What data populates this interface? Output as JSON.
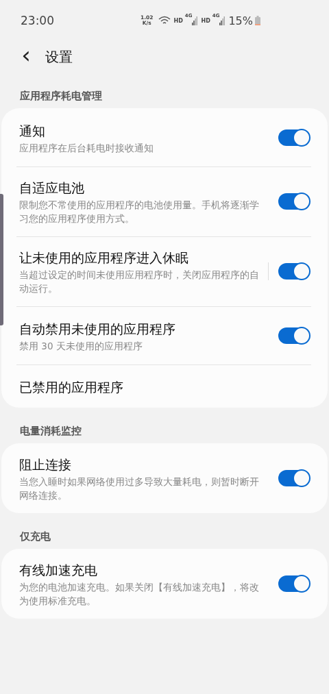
{
  "status_bar": {
    "time": "23:00",
    "speed": [
      "1.02",
      "K/s"
    ],
    "network": [
      "HD",
      "4G",
      "HD",
      "4G"
    ],
    "battery": "15%"
  },
  "header": {
    "back": "‹",
    "title": "设置"
  },
  "sections": [
    {
      "title": "应用程序耗电管理",
      "items": [
        {
          "kind": "switch",
          "title": "通知",
          "subtitle": "应用程序在后台耗电时接收通知",
          "on": true,
          "divider": false
        },
        {
          "kind": "switch",
          "title": "自适应电池",
          "subtitle": "限制您不常使用的应用程序的电池使用量。手机将逐渐学习您的应用程序使用方式。",
          "on": true,
          "divider": false
        },
        {
          "kind": "switch",
          "title": "让未使用的应用程序进入休眠",
          "subtitle": "当超过设定的时间未使用应用程序时，关闭应用程序的自动运行。",
          "on": true,
          "divider": true
        },
        {
          "kind": "switch",
          "title": "自动禁用未使用的应用程序",
          "subtitle": "禁用 30 天未使用的应用程序",
          "on": true,
          "divider": false
        },
        {
          "kind": "link",
          "title": "已禁用的应用程序"
        }
      ]
    },
    {
      "title": "电量消耗监控",
      "items": [
        {
          "kind": "switch",
          "title": "阻止连接",
          "subtitle": "当您入睡时如果网络使用过多导致大量耗电，则暂时断开网络连接。",
          "on": true,
          "divider": false
        }
      ]
    },
    {
      "title": "仅充电",
      "items": [
        {
          "kind": "switch",
          "title": "有线加速充电",
          "subtitle": "为您的电池加速充电。如果关闭【有线加速充电】，将改为使用标准充电。",
          "on": true,
          "divider": false
        }
      ]
    }
  ]
}
